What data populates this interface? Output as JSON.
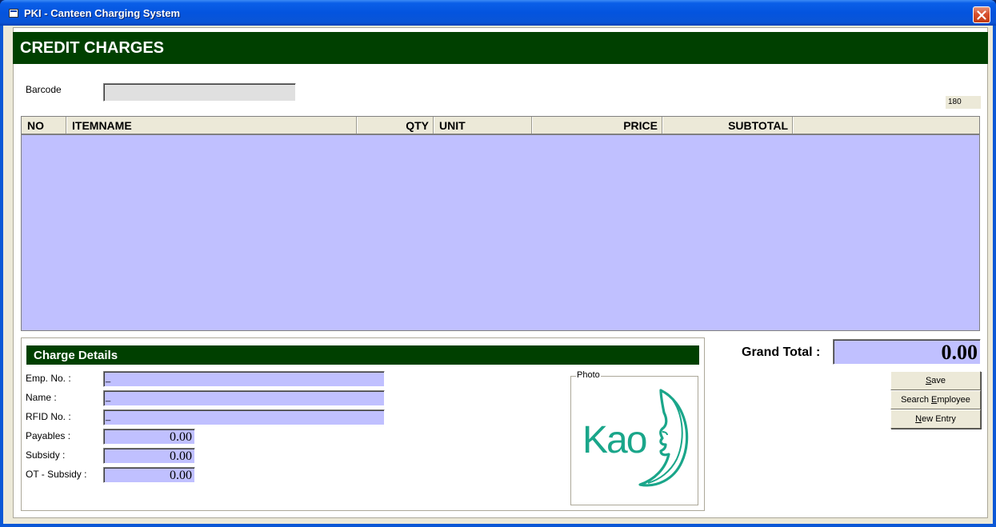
{
  "window": {
    "title": "PKI - Canteen Charging System"
  },
  "header": {
    "title": "CREDIT CHARGES"
  },
  "barcode": {
    "label": "Barcode",
    "value": ""
  },
  "counter": {
    "value": "180"
  },
  "grid": {
    "columns": [
      "NO",
      "ITEMNAME",
      "QTY",
      "UNIT",
      "PRICE",
      "SUBTOTAL"
    ],
    "rows": []
  },
  "charge_details": {
    "title": "Charge Details",
    "emp_no": {
      "label": "Emp. No. :",
      "value": "_"
    },
    "name": {
      "label": "Name :",
      "value": "_"
    },
    "rfid_no": {
      "label": "RFID No. :",
      "value": "_"
    },
    "payables": {
      "label": "Payables :",
      "value": "0.00"
    },
    "subsidy": {
      "label": "Subsidy :",
      "value": "0.00"
    },
    "ot_subsidy": {
      "label": "OT - Subsidy :",
      "value": "0.00"
    },
    "photo": {
      "label": "Photo",
      "logo_text": "Kao"
    }
  },
  "totals": {
    "grand_total_label": "Grand Total :",
    "grand_total_value": "0.00"
  },
  "buttons": {
    "save": {
      "pre": "",
      "mnemonic": "S",
      "post": "ave"
    },
    "search_employee": {
      "pre": "Search ",
      "mnemonic": "E",
      "post": "mployee"
    },
    "new_entry": {
      "pre": "",
      "mnemonic": "N",
      "post": "ew Entry"
    }
  },
  "colors": {
    "header_green": "#004000",
    "grid_lavender": "#C0C0FF",
    "logo_teal": "#1AA68A"
  }
}
